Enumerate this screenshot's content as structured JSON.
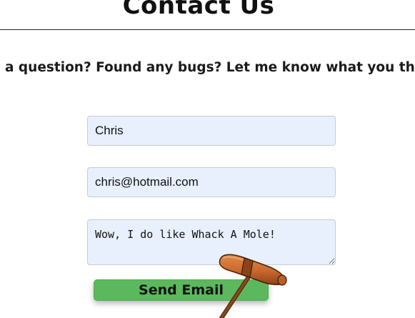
{
  "page": {
    "title": "Contact Us",
    "tagline": "a question? Found any bugs? Let me know what you th"
  },
  "form": {
    "name_value": "Chris",
    "email_value": "chris@hotmail.com",
    "message_value": "Wow, I do like Whack A Mole!",
    "send_label": "Send Email"
  },
  "colors": {
    "field_background": "#e8f0fe",
    "button_background": "#5cb85c",
    "mallet_head": "#c8682e",
    "mallet_handle": "#7a3b16"
  },
  "cursor": {
    "icon": "mallet-cursor-icon"
  }
}
